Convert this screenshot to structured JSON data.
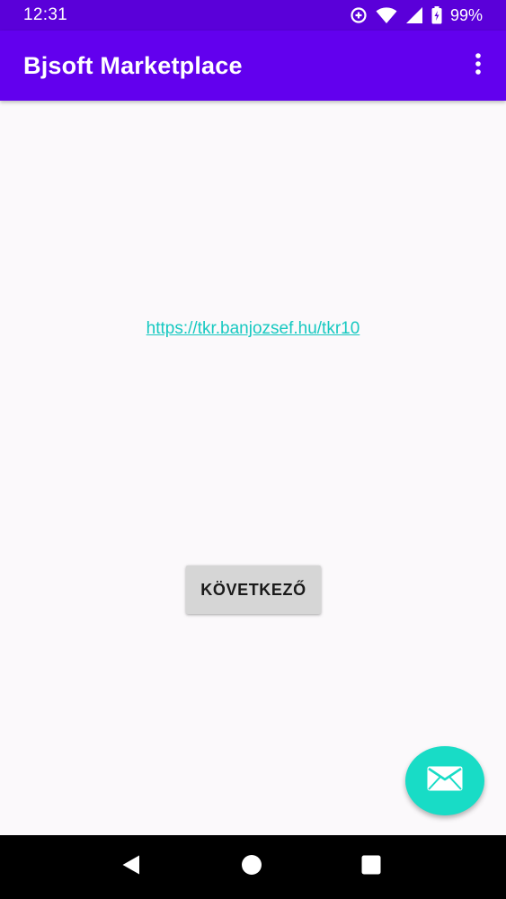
{
  "status_bar": {
    "time": "12:31",
    "battery_percent": "99%",
    "icons": [
      "data-saver-icon",
      "wifi-icon",
      "cell-signal-icon",
      "battery-icon"
    ]
  },
  "app_bar": {
    "title": "Bjsoft Marketplace",
    "menu_icon": "more-vert-icon"
  },
  "main": {
    "link_text": "https://tkr.banjozsef.hu/tkr10",
    "next_button_label": "KÖVETKEZŐ"
  },
  "fab": {
    "icon": "email-icon"
  },
  "nav_bar": {
    "icons": [
      "back-icon",
      "home-icon",
      "recents-icon"
    ]
  },
  "colors": {
    "status_bar": "#5a00d9",
    "app_bar": "#6200ee",
    "link": "#17c9c1",
    "fab": "#18dcc6",
    "background": "#fbf9fb"
  }
}
